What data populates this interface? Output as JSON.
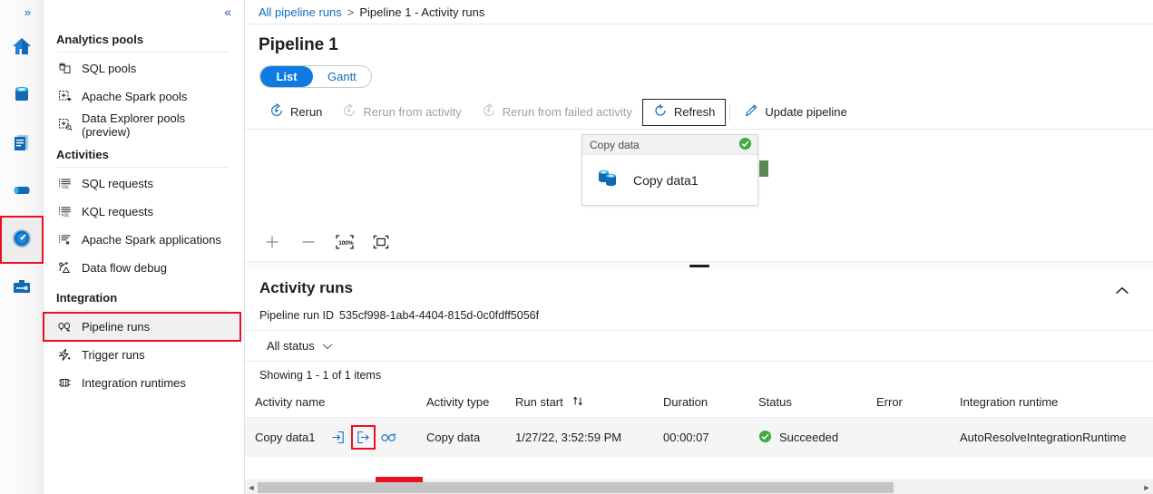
{
  "rail": {
    "expand_label": "»",
    "items": [
      {
        "name": "home-icon",
        "title": "Home"
      },
      {
        "name": "data-icon",
        "title": "Data"
      },
      {
        "name": "develop-icon",
        "title": "Develop"
      },
      {
        "name": "integrate-icon",
        "title": "Integrate"
      },
      {
        "name": "monitor-icon",
        "title": "Monitor",
        "selected": true
      },
      {
        "name": "manage-icon",
        "title": "Manage"
      }
    ]
  },
  "nav": {
    "collapse_label": "«",
    "groups": [
      {
        "title": "Analytics pools",
        "items": [
          {
            "label": "SQL pools",
            "icon": "sql-pools-icon"
          },
          {
            "label": "Apache Spark pools",
            "icon": "spark-pools-icon"
          },
          {
            "label": "Data Explorer pools (preview)",
            "icon": "data-explorer-pools-icon"
          }
        ]
      },
      {
        "title": "Activities",
        "items": [
          {
            "label": "SQL requests",
            "icon": "sql-requests-icon"
          },
          {
            "label": "KQL requests",
            "icon": "kql-requests-icon"
          },
          {
            "label": "Apache Spark applications",
            "icon": "spark-applications-icon"
          },
          {
            "label": "Data flow debug",
            "icon": "data-flow-debug-icon"
          }
        ]
      },
      {
        "title": "Integration",
        "items": [
          {
            "label": "Pipeline runs",
            "icon": "pipeline-runs-icon",
            "highlighted": true
          },
          {
            "label": "Trigger runs",
            "icon": "trigger-runs-icon"
          },
          {
            "label": "Integration runtimes",
            "icon": "integration-runtimes-icon"
          }
        ]
      }
    ]
  },
  "breadcrumb": {
    "root": "All pipeline runs",
    "separator": ">",
    "current": "Pipeline 1 - Activity runs"
  },
  "page": {
    "title": "Pipeline 1"
  },
  "view_toggle": {
    "options": [
      "List",
      "Gantt"
    ],
    "selected": "List"
  },
  "commands": [
    {
      "label": "Rerun",
      "icon": "rerun-icon",
      "disabled": false,
      "boxed": false
    },
    {
      "label": "Rerun from activity",
      "icon": "rerun-from-activity-icon",
      "disabled": true,
      "boxed": false
    },
    {
      "label": "Rerun from failed activity",
      "icon": "rerun-from-failed-activity-icon",
      "disabled": true,
      "boxed": false
    },
    {
      "label": "Refresh",
      "icon": "refresh-icon",
      "disabled": false,
      "boxed": true
    },
    {
      "label": "Update pipeline",
      "icon": "pencil-icon",
      "disabled": false,
      "boxed": false
    }
  ],
  "canvas": {
    "node": {
      "header": "Copy data",
      "status_icon": "success-check-icon",
      "label": "Copy data1",
      "activity_icon": "copy-data-icon"
    },
    "tools": [
      {
        "name": "zoom-in-icon",
        "glyph": "+"
      },
      {
        "name": "zoom-out-icon",
        "glyph": "−"
      },
      {
        "name": "zoom-to-100-icon",
        "glyph": "100%"
      },
      {
        "name": "fit-to-screen-icon",
        "glyph": "□"
      }
    ]
  },
  "activity_runs": {
    "title": "Activity runs",
    "collapse_icon": "chevron-up-icon",
    "run_id_label": "Pipeline run ID",
    "run_id_value": "535cf998-1ab4-4404-815d-0c0fdff5056f",
    "status_filter": "All status",
    "status_filter_caret": "chevron-down-icon",
    "showing": "Showing 1 - 1 of 1 items",
    "columns": [
      "Activity name",
      "Activity type",
      "Run start",
      "Duration",
      "Status",
      "Error",
      "Integration runtime"
    ],
    "sort_column": "Run start",
    "sort_icon": "sort-arrows-icon",
    "rows": [
      {
        "activity_name": "Copy data1",
        "row_icons": [
          {
            "name": "input-icon",
            "highlighted": false
          },
          {
            "name": "output-icon",
            "highlighted": true
          },
          {
            "name": "details-glasses-icon",
            "highlighted": false
          }
        ],
        "activity_type": "Copy data",
        "run_start": "1/27/22, 3:52:59 PM",
        "duration": "00:00:07",
        "status": "Succeeded",
        "status_icon": "success-check-icon",
        "error": "",
        "integration_runtime": "AutoResolveIntegrationRuntime"
      }
    ]
  },
  "scrollbar": {
    "left_arrow": "◄",
    "right_arrow": "►"
  },
  "colors": {
    "accent_blue": "#0f6cbd",
    "toggle_blue": "#0f7ae0",
    "success_green": "#107c10",
    "highlight_red": "#e81123",
    "port_green": "#5a8a4f"
  }
}
